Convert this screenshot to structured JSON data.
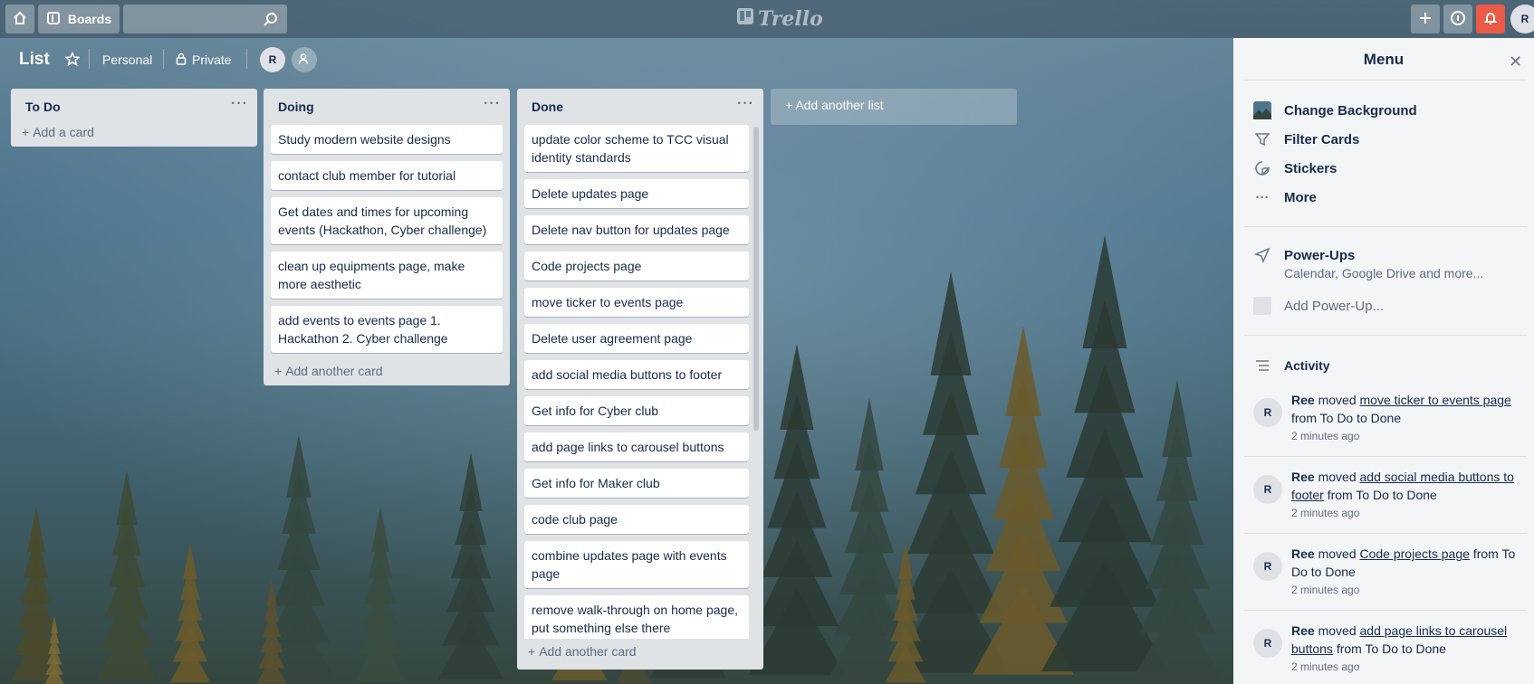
{
  "header": {
    "boards_label": "Boards",
    "search_placeholder": "",
    "logo_text": "Trello",
    "user_initial": "R"
  },
  "board": {
    "title": "List",
    "team_label": "Personal",
    "visibility_label": "Private",
    "member_initial": "R"
  },
  "lists": [
    {
      "title": "To Do",
      "cards": [],
      "add_label": "Add a card"
    },
    {
      "title": "Doing",
      "cards": [
        "Study modern website designs",
        "contact club member for tutorial",
        "Get dates and times for upcoming events (Hackathon, Cyber challenge)",
        "clean up equipments page, make more aesthetic",
        "add events to events page 1. Hackathon 2. Cyber challenge"
      ],
      "add_label": "Add another card"
    },
    {
      "title": "Done",
      "cards": [
        "update color scheme to TCC visual identity standards",
        "Delete updates page",
        "Delete nav button for updates page",
        "Code projects page",
        "move ticker to events page",
        "Delete user agreement page",
        "add social media buttons to footer",
        "Get info for Cyber club",
        "add page links to carousel buttons",
        "Get info for Maker club",
        "code club page",
        "combine updates page with events page",
        "remove walk-through on home page, put something else there"
      ],
      "add_label": "Add another card"
    }
  ],
  "add_list_label": "Add another list",
  "menu": {
    "title": "Menu",
    "items": {
      "change_background": "Change Background",
      "filter_cards": "Filter Cards",
      "stickers": "Stickers",
      "more": "More"
    },
    "powerups": {
      "title": "Power-Ups",
      "subtitle": "Calendar, Google Drive and more...",
      "add": "Add Power-Up..."
    },
    "activity_title": "Activity",
    "activity": [
      {
        "initial": "R",
        "user": "Ree",
        "verb": "moved",
        "card": "move ticker to events page",
        "detail": "from To Do to Done",
        "time": "2 minutes ago"
      },
      {
        "initial": "R",
        "user": "Ree",
        "verb": "moved",
        "card": "add social media buttons to footer",
        "detail": "from To Do to Done",
        "time": "2 minutes ago"
      },
      {
        "initial": "R",
        "user": "Ree",
        "verb": "moved",
        "card": "Code projects page",
        "detail": "from To Do to Done",
        "time": "2 minutes ago"
      },
      {
        "initial": "R",
        "user": "Ree",
        "verb": "moved",
        "card": "add page links to carousel buttons",
        "detail": "from To Do to Done",
        "time": "2 minutes ago"
      }
    ]
  },
  "colors": {
    "list_bg": "#dfe3e6",
    "menu_bg": "#f4f5f7",
    "notification_red": "#eb5a46"
  }
}
